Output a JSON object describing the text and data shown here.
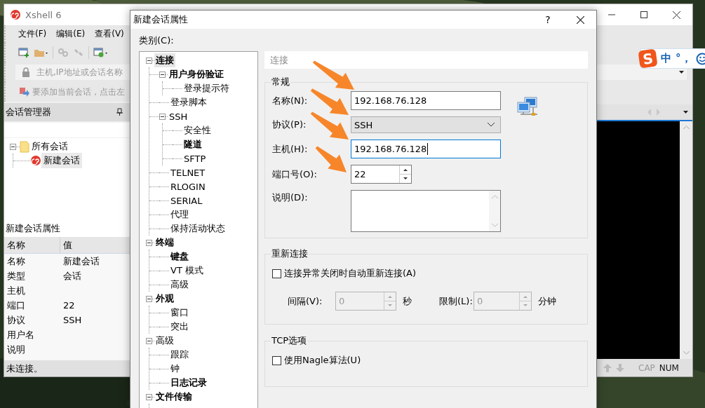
{
  "main_window": {
    "title": "Xshell 6",
    "menu": [
      "文件(F)",
      "编辑(E)",
      "查看(V)"
    ],
    "address_placeholder": "主机,IP地址或会话名称",
    "hint": "要添加当前会话，点击左",
    "session_manager": {
      "title": "会话管理器",
      "tree": [
        {
          "label": "所有会话",
          "kind": "folder",
          "expanded": true,
          "selected": false,
          "children": [
            {
              "label": "新建会话",
              "kind": "session",
              "selected": true
            }
          ]
        }
      ]
    },
    "properties": {
      "title": "新建会话属性",
      "columns": [
        "名称",
        "值"
      ],
      "rows": [
        {
          "name": "名称",
          "value": "新建会话"
        },
        {
          "name": "类型",
          "value": "会话"
        },
        {
          "name": "主机"
        },
        {
          "name": "端口",
          "value": "22"
        },
        {
          "name": "协议",
          "value": "SSH"
        },
        {
          "name": "用户名"
        },
        {
          "name": "说明"
        }
      ]
    },
    "status": "未连接。",
    "indicators": [
      {
        "label": "CAP",
        "on": false
      },
      {
        "label": "NUM",
        "on": true
      }
    ]
  },
  "ime_bar": {
    "logo": "S",
    "mode": "中",
    "punctuation": "°，"
  },
  "dialog": {
    "title": "新建会话属性",
    "help_button": "?",
    "category_label": "类别(C):",
    "categories": [
      {
        "label": "连接",
        "bold": true,
        "selected": true,
        "expanded": true,
        "children": [
          {
            "label": "用户身份验证",
            "bold": true,
            "selected": false,
            "expanded": true,
            "children": [
              {
                "label": "登录提示符",
                "bold": false,
                "selected": false
              }
            ]
          },
          {
            "label": "登录脚本",
            "bold": false,
            "selected": false
          },
          {
            "label": "SSH",
            "bold": false,
            "selected": false,
            "expanded": true,
            "children": [
              {
                "label": "安全性",
                "bold": false,
                "selected": false
              },
              {
                "label": "隧道",
                "bold": true,
                "selected": false
              },
              {
                "label": "SFTP",
                "bold": false,
                "selected": false
              }
            ]
          },
          {
            "label": "TELNET",
            "bold": false,
            "selected": false
          },
          {
            "label": "RLOGIN",
            "bold": false,
            "selected": false
          },
          {
            "label": "SERIAL",
            "bold": false,
            "selected": false
          },
          {
            "label": "代理",
            "bold": false,
            "selected": false
          },
          {
            "label": "保持活动状态",
            "bold": false,
            "selected": false
          }
        ]
      },
      {
        "label": "终端",
        "bold": true,
        "selected": false,
        "expanded": true,
        "children": [
          {
            "label": "键盘",
            "bold": true,
            "selected": false
          },
          {
            "label": "VT 模式",
            "bold": false,
            "selected": false
          },
          {
            "label": "高级",
            "bold": false,
            "selected": false
          }
        ]
      },
      {
        "label": "外观",
        "bold": true,
        "selected": false,
        "expanded": true,
        "children": [
          {
            "label": "窗口",
            "bold": false,
            "selected": false
          },
          {
            "label": "突出",
            "bold": false,
            "selected": false
          }
        ]
      },
      {
        "label": "高级",
        "bold": false,
        "selected": false,
        "expanded": true,
        "children": [
          {
            "label": "跟踪",
            "bold": false,
            "selected": false
          },
          {
            "label": "钟",
            "bold": false,
            "selected": false
          },
          {
            "label": "日志记录",
            "bold": true,
            "selected": false
          }
        ]
      },
      {
        "label": "文件传输",
        "bold": true,
        "selected": false,
        "expanded": true
      }
    ],
    "section_title": "连接",
    "general": {
      "title": "常规",
      "fields": [
        {
          "kind": "text",
          "label": "名称(N):",
          "value": "192.168.76.128",
          "focused": false
        },
        {
          "kind": "select",
          "label": "协议(P):",
          "value": "SSH"
        },
        {
          "kind": "text",
          "label": "主机(H):",
          "value": "192.168.76.128",
          "focused": true
        },
        {
          "kind": "spin",
          "label": "端口号(O):",
          "value": "22"
        },
        {
          "kind": "textarea",
          "label": "说明(D):"
        }
      ]
    },
    "reconnect": {
      "title": "重新连接",
      "checkbox": {
        "label": "连接异常关闭时自动重新连接(A)",
        "checked": false
      },
      "spinners": [
        {
          "label": "间隔(V):",
          "value": "0",
          "unit": "秒",
          "disabled": true
        },
        {
          "label": "限制(L):",
          "value": "0",
          "unit": "分钟",
          "disabled": true
        }
      ]
    },
    "tcp": {
      "title": "TCP选项",
      "checkbox": {
        "label": "使用Nagle算法(U)",
        "checked": false
      }
    }
  }
}
